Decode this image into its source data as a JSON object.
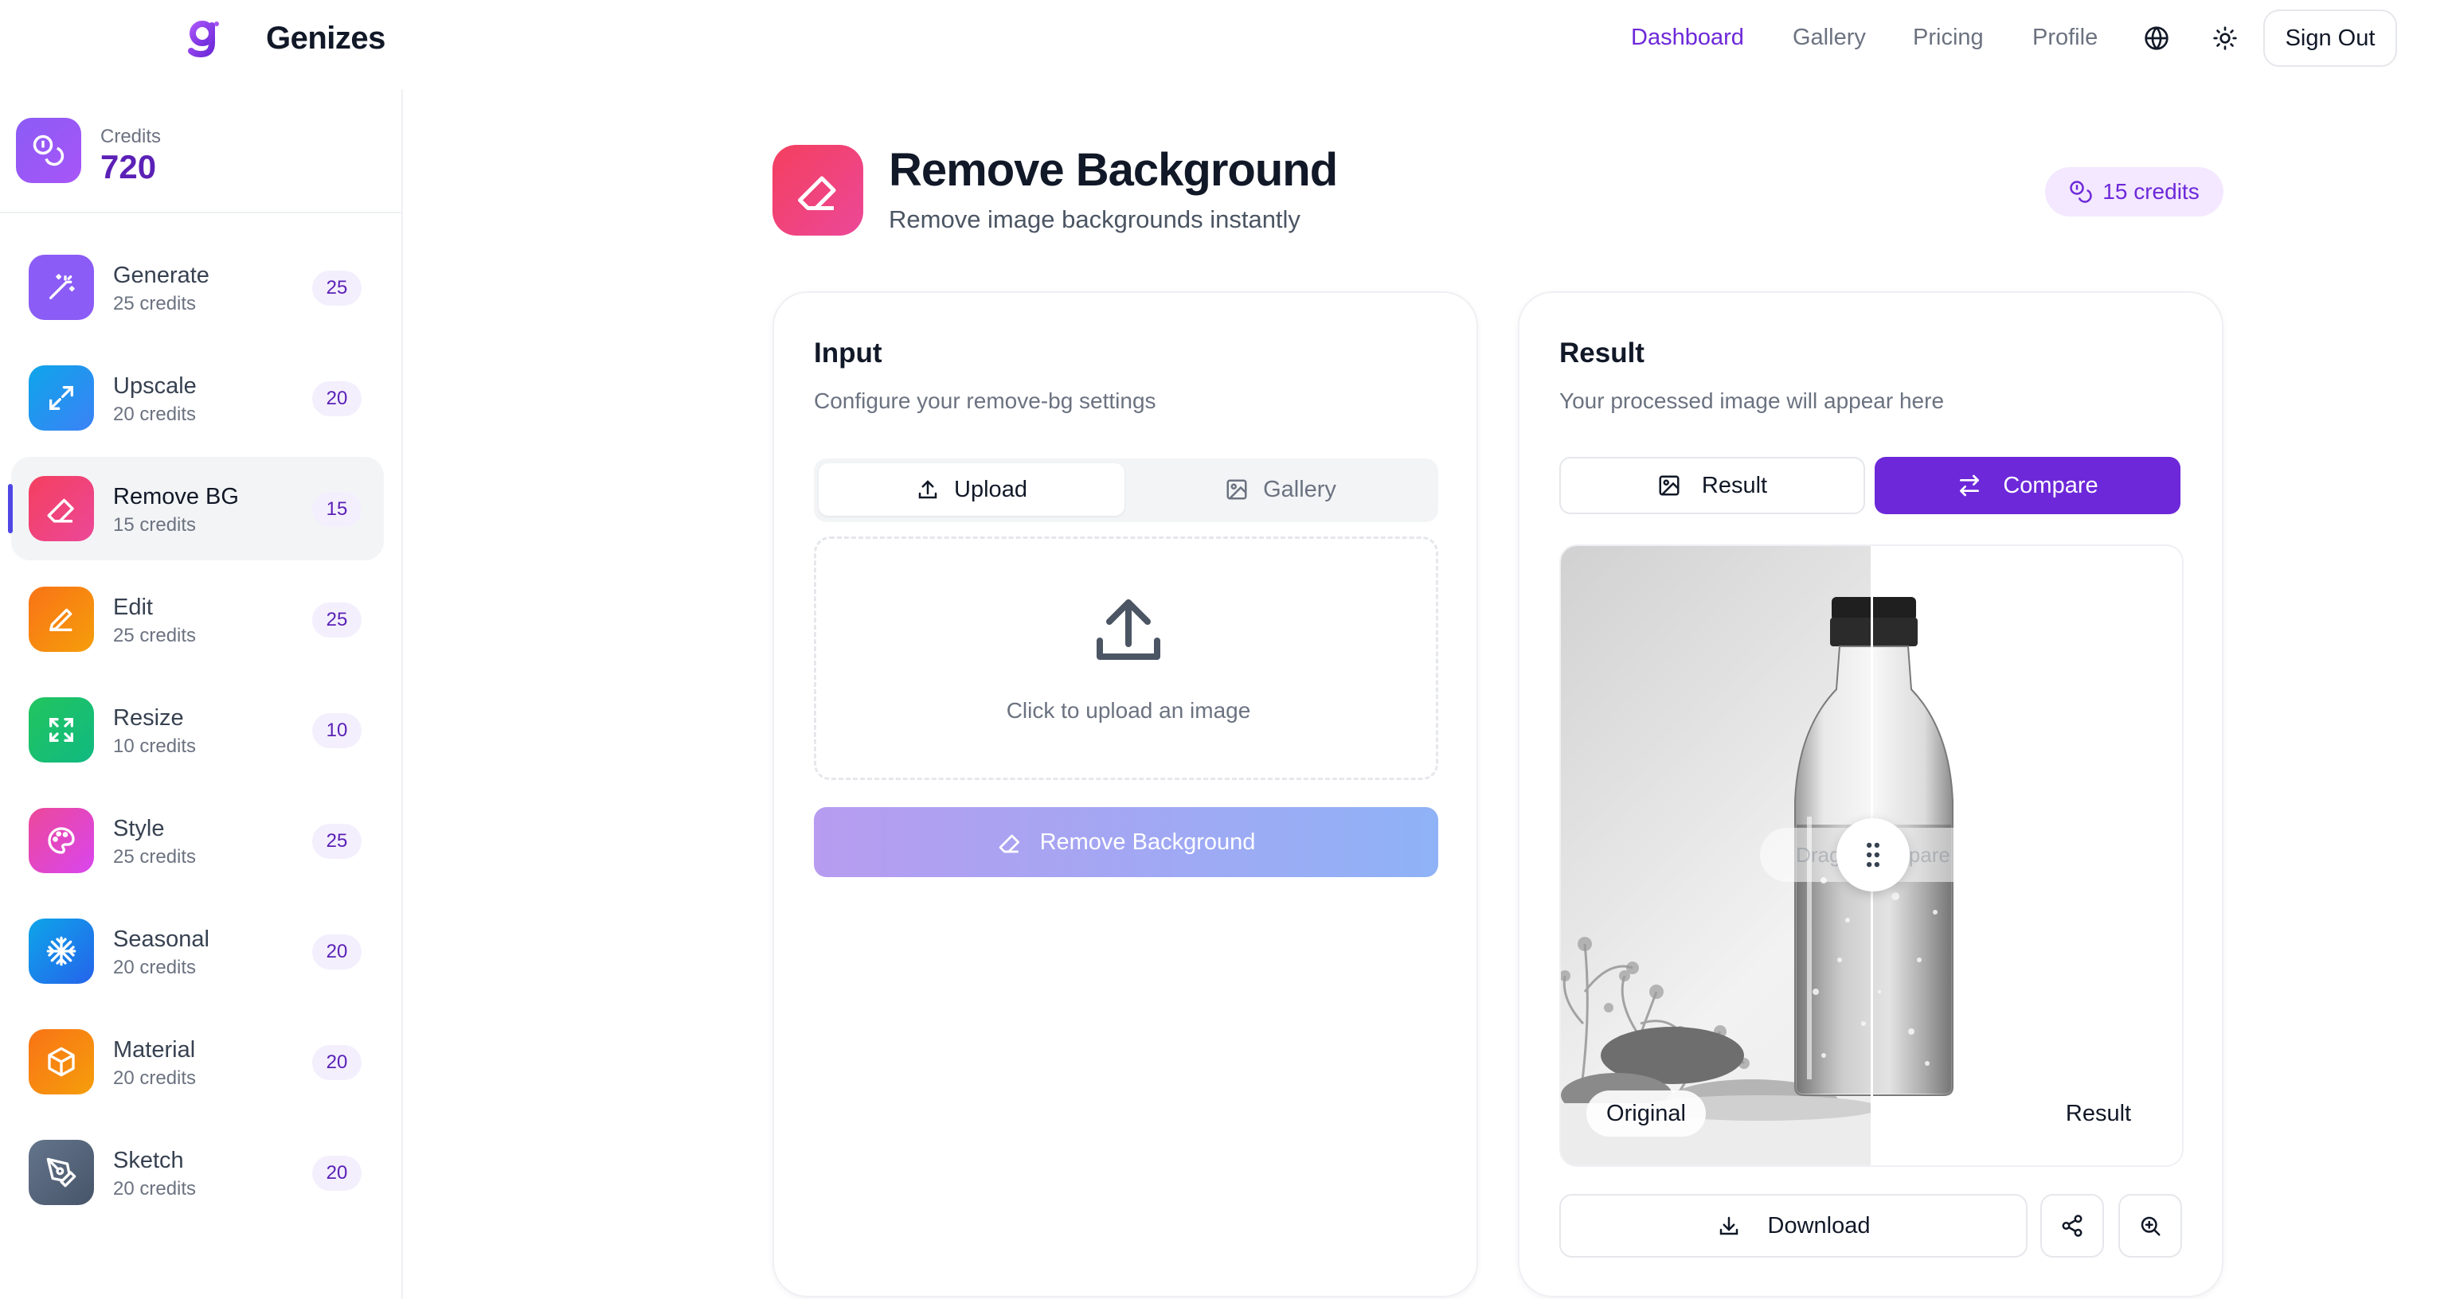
{
  "app": {
    "brand": "Genizes"
  },
  "nav": {
    "links": [
      "Dashboard",
      "Gallery",
      "Pricing",
      "Profile"
    ],
    "active": "Dashboard",
    "sign_out": "Sign Out"
  },
  "sidebar": {
    "credits_label": "Credits",
    "credits_value": "720",
    "tools": [
      {
        "name": "Generate",
        "sub": "25 credits",
        "badge": "25",
        "color": "#8b5cf6",
        "icon": "magic-wand-icon"
      },
      {
        "name": "Upscale",
        "sub": "20 credits",
        "badge": "20",
        "color": "#0ea5e9",
        "icon": "expand-arrows-icon"
      },
      {
        "name": "Remove BG",
        "sub": "15 credits",
        "badge": "15",
        "color": "#f43f5e",
        "icon": "eraser-icon",
        "active": true
      },
      {
        "name": "Edit",
        "sub": "25 credits",
        "badge": "25",
        "color": "#f97316",
        "icon": "pencil-icon"
      },
      {
        "name": "Resize",
        "sub": "10 credits",
        "badge": "10",
        "color": "#22c55e",
        "icon": "resize-icon"
      },
      {
        "name": "Style",
        "sub": "25 credits",
        "badge": "25",
        "color": "#ec4899",
        "icon": "palette-icon"
      },
      {
        "name": "Seasonal",
        "sub": "20 credits",
        "badge": "20",
        "color": "#0ea5e9",
        "icon": "snowflake-icon"
      },
      {
        "name": "Material",
        "sub": "20 credits",
        "badge": "20",
        "color": "#f97316",
        "icon": "cube-icon"
      },
      {
        "name": "Sketch",
        "sub": "20 credits",
        "badge": "20",
        "color": "#64748b",
        "icon": "pen-tool-icon"
      }
    ]
  },
  "header": {
    "title": "Remove Background",
    "subtitle": "Remove image backgrounds instantly",
    "cost": "15 credits"
  },
  "input_card": {
    "title": "Input",
    "subtitle": "Configure your remove-bg settings",
    "tab_upload": "Upload",
    "tab_gallery": "Gallery",
    "dropzone_text": "Click to upload an image",
    "submit": "Remove Background"
  },
  "result_card": {
    "title": "Result",
    "subtitle": "Your processed image will appear here",
    "tab_result": "Result",
    "tab_compare": "Compare",
    "drag_hint": "Drag to compare",
    "label_original": "Original",
    "label_result": "Result",
    "download": "Download"
  },
  "colors": {
    "accent": "#6d28d9",
    "active_nav": "#6d28d9"
  }
}
